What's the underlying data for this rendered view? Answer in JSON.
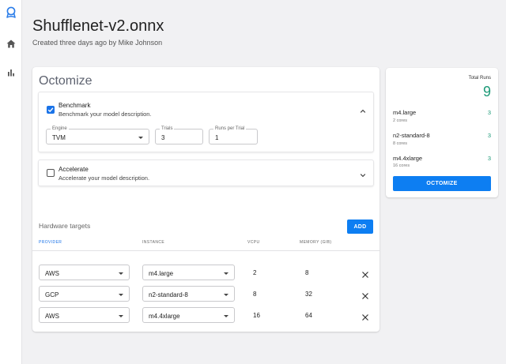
{
  "page": {
    "title": "Shufflenet-v2.onnx",
    "subtitle": "Created three days ago by Mike Johnson"
  },
  "nav": {
    "icons": [
      "logo-icon",
      "home-icon",
      "bar-chart-icon"
    ]
  },
  "octomize": {
    "heading": "Octomize",
    "benchmark": {
      "title": "Benchmark",
      "description": "Benchmark your model description.",
      "checked": true,
      "engine": {
        "label": "Engine",
        "value": "TVM"
      },
      "trials": {
        "label": "Trials",
        "value": "3"
      },
      "runs_per_trial": {
        "label": "Runs per Trial",
        "value": "1"
      }
    },
    "accelerate": {
      "title": "Accelerate",
      "description": "Accelerate your model description.",
      "checked": false
    }
  },
  "hardware": {
    "title": "Hardware targets",
    "add_label": "ADD",
    "columns": [
      "PROVIDER",
      "INSTANCE",
      "VCPU",
      "MEMORY (GIB)"
    ],
    "rows": [
      {
        "provider": "AWS",
        "instance": "m4.large",
        "vcpu": "2",
        "memory": "8"
      },
      {
        "provider": "GCP",
        "instance": "n2-standard-8",
        "vcpu": "8",
        "memory": "32"
      },
      {
        "provider": "AWS",
        "instance": "m4.4xlarge",
        "vcpu": "16",
        "memory": "64"
      }
    ]
  },
  "summary": {
    "total_runs_label": "Total Runs",
    "total_runs": "9",
    "items": [
      {
        "name": "m4.large",
        "cores": "2 cores",
        "count": "3"
      },
      {
        "name": "n2-standard-8",
        "cores": "8 cores",
        "count": "3"
      },
      {
        "name": "m4.4xlarge",
        "cores": "16 cores",
        "count": "3"
      }
    ],
    "button_label": "OCTOMIZE"
  },
  "colors": {
    "accent": "#0d7ef2",
    "count_green": "#1d9a78",
    "checkbox_blue": "#1a73e8"
  }
}
